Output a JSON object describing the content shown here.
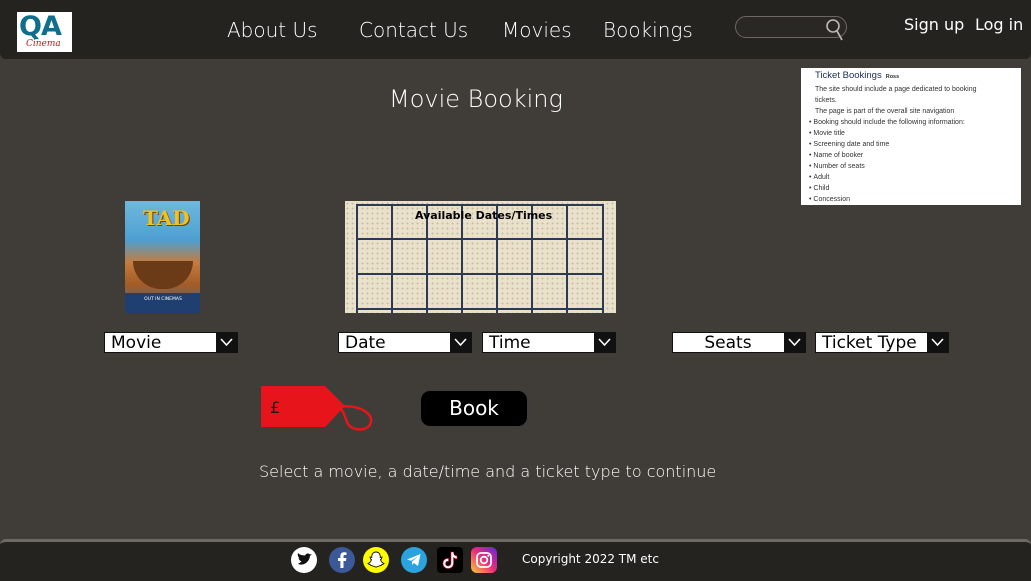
{
  "header": {
    "logo": {
      "text": "QA",
      "subtext": "Cinema"
    },
    "nav": [
      {
        "label": "About Us"
      },
      {
        "label": "Contact Us"
      },
      {
        "label": "Movies"
      },
      {
        "label": "Bookings"
      }
    ],
    "search": {
      "placeholder": "",
      "icon": "search-icon"
    },
    "auth": {
      "signup": "Sign up",
      "login": "Log in"
    }
  },
  "main": {
    "title": "Movie Booking",
    "poster": {
      "title": "TAD",
      "caption": "OUT IN CINEMAS"
    },
    "dates_panel": {
      "title": "Available Dates/Times"
    },
    "selects": {
      "movie": "Movie",
      "date": "Date",
      "time": "Time",
      "seats": "Seats",
      "ticket_type": "Ticket Type"
    },
    "price": {
      "symbol": "£",
      "tag_color": "#e8141c"
    },
    "book_button": "Book",
    "hint": "Select a movie, a date/time and a ticket type to continue"
  },
  "requirements_note": {
    "heading": "Ticket Bookings",
    "author": "Ross",
    "lines": [
      "The site should include a page dedicated to booking",
      "tickets.",
      "The page is part of the overall site navigation"
    ],
    "bullets": [
      "Booking should include the following information:",
      "Movie title",
      "Screening date and time",
      "Name of booker",
      "Number of seats",
      "Adult",
      "Child",
      "Concession"
    ]
  },
  "footer": {
    "social": [
      "twitter-icon",
      "facebook-icon",
      "snapchat-icon",
      "telegram-icon",
      "tiktok-icon",
      "instagram-icon"
    ],
    "copyright": "Copyright 2022 TM etc"
  },
  "colors": {
    "background": "#403d39",
    "bar": "#252320",
    "accent_red": "#e8141c"
  }
}
